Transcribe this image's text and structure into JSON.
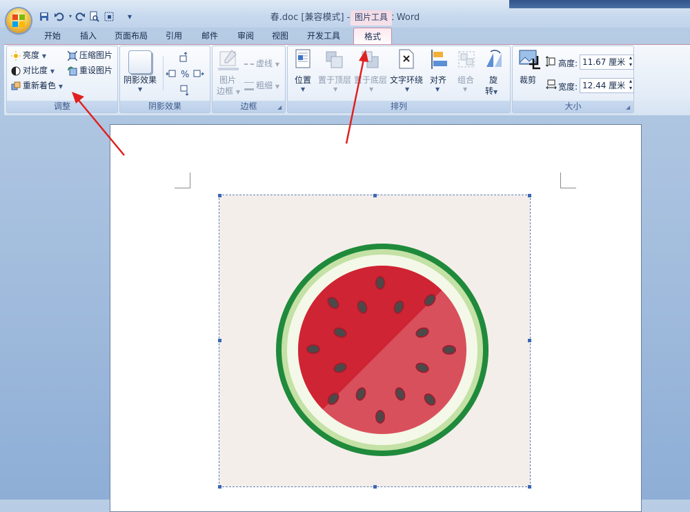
{
  "window": {
    "title": "春.doc [兼容模式] - Microsoft Word",
    "context_tab_title": "图片工具"
  },
  "quick_access": {
    "save": "save-icon",
    "undo": "undo-icon",
    "redo": "redo-icon",
    "print_preview": "print-preview-icon",
    "select": "select-icon",
    "customize": "customize-dropdown-icon"
  },
  "tabs": [
    "开始",
    "插入",
    "页面布局",
    "引用",
    "邮件",
    "审阅",
    "视图",
    "开发工具",
    "格式"
  ],
  "active_tab": "格式",
  "ribbon": {
    "adjust": {
      "label": "调整",
      "brightness": "亮度",
      "contrast": "对比度",
      "recolor": "重新着色",
      "compress": "压缩图片",
      "reset": "重设图片"
    },
    "shadow": {
      "label": "阴影效果",
      "shadow_effects": "阴影效果"
    },
    "border": {
      "label": "边框",
      "picture_border_1": "图片",
      "picture_border_2": "边框",
      "dashes": "虚线",
      "weight": "粗细"
    },
    "arrange": {
      "label": "排列",
      "position": "位置",
      "bring_front": "置于顶层",
      "send_back": "置于底层",
      "text_wrap": "文字环绕",
      "align": "对齐",
      "group": "组合",
      "rotate_1": "旋",
      "rotate_2": "转"
    },
    "size": {
      "label": "大小",
      "crop": "裁剪",
      "height_label": "高度:",
      "height_value": "11.67 厘米",
      "width_label": "宽度:",
      "width_value": "12.44 厘米"
    }
  },
  "colors": {
    "accent_pink": "#f6dde8",
    "ribbon_blue": "#dbe6f4",
    "annotation_red": "#e02020",
    "melon_green_dark": "#1f8a3b",
    "melon_flesh": "#d63040",
    "melon_seed": "#4a4a4a"
  }
}
